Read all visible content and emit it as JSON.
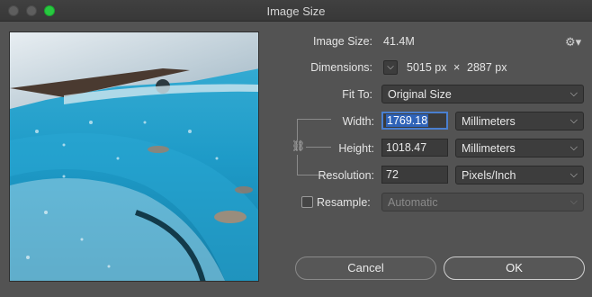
{
  "window": {
    "title": "Image Size",
    "traffic_lights": [
      "close",
      "minimize",
      "zoom"
    ]
  },
  "preview": {
    "description_icon": "image-preview"
  },
  "image_size": {
    "label": "Image Size:",
    "value": "41.4M"
  },
  "dimensions": {
    "label": "Dimensions:",
    "width": "5015 px",
    "separator": "×",
    "height": "2887 px"
  },
  "fit_to": {
    "label": "Fit To:",
    "value": "Original Size"
  },
  "width": {
    "label": "Width:",
    "value": "1769.18",
    "unit": "Millimeters"
  },
  "height": {
    "label": "Height:",
    "value": "1018.47",
    "unit": "Millimeters"
  },
  "resolution": {
    "label": "Resolution:",
    "value": "72",
    "unit": "Pixels/Inch"
  },
  "resample": {
    "label": "Resample:",
    "checked": false,
    "value": "Automatic"
  },
  "buttons": {
    "cancel": "Cancel",
    "ok": "OK"
  },
  "icons": {
    "gear": "gear-icon",
    "chevron": "chevron-down-icon",
    "link": "link-icon"
  },
  "colors": {
    "background": "#535353",
    "accent": "#4a7fd0",
    "zoom_green": "#28c840"
  }
}
